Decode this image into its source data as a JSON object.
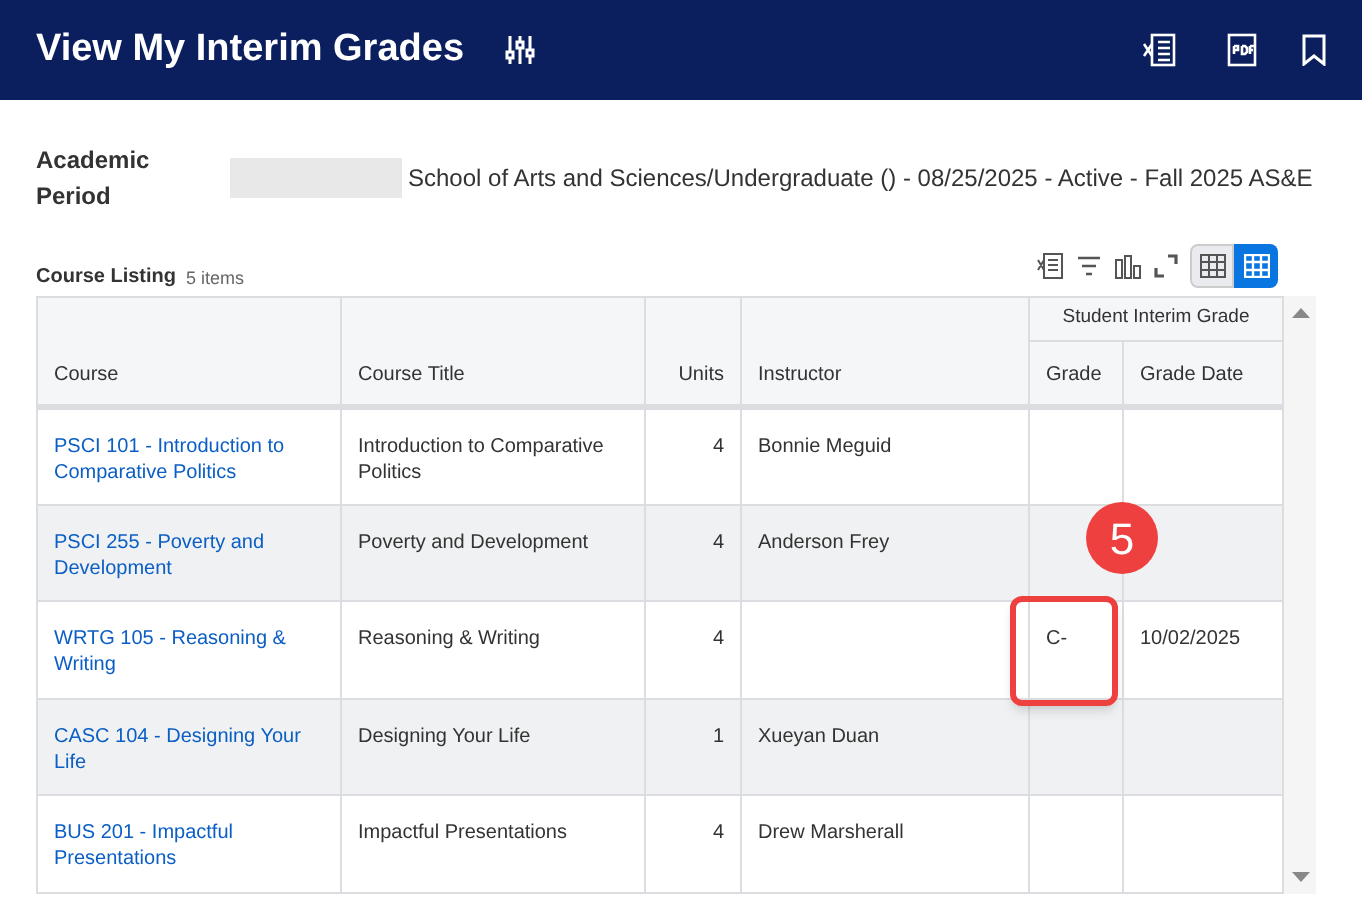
{
  "header": {
    "title": "View My Interim Grades"
  },
  "academic_period": {
    "label": "Academic Period",
    "value": "School of Arts and Sciences/Undergraduate () - 08/25/2025 - Active - Fall 2025 AS&E"
  },
  "listing": {
    "title": "Course Listing",
    "count": "5 items"
  },
  "table": {
    "group_header": "Student Interim Grade",
    "columns": [
      "Course",
      "Course Title",
      "Units",
      "Instructor",
      "Grade",
      "Grade Date"
    ],
    "rows": [
      {
        "course": "PSCI 101 - Introduction to Comparative Politics",
        "title": "Introduction to Comparative Politics",
        "units": "4",
        "instructor": "Bonnie Meguid"
      },
      {
        "course": "PSCI 255 - Poverty and Development",
        "title": "Poverty and Development",
        "units": "4",
        "instructor": "Anderson Frey"
      },
      {
        "course": "WRTG 105 - Reasoning & Writing",
        "title": "Reasoning & Writing",
        "units": "4",
        "grade": "C-",
        "grade_date": "10/02/2025",
        "highlighted": true
      },
      {
        "course": "CASC 104 - Designing Your Life",
        "title": "Designing Your Life",
        "units": "1",
        "instructor": "Xueyan Duan"
      },
      {
        "course": "BUS 201 - Impactful Presentations",
        "title": "Impactful Presentations",
        "units": "4",
        "instructor": "Drew Marsherall"
      }
    ]
  },
  "callout": {
    "number": "5"
  }
}
